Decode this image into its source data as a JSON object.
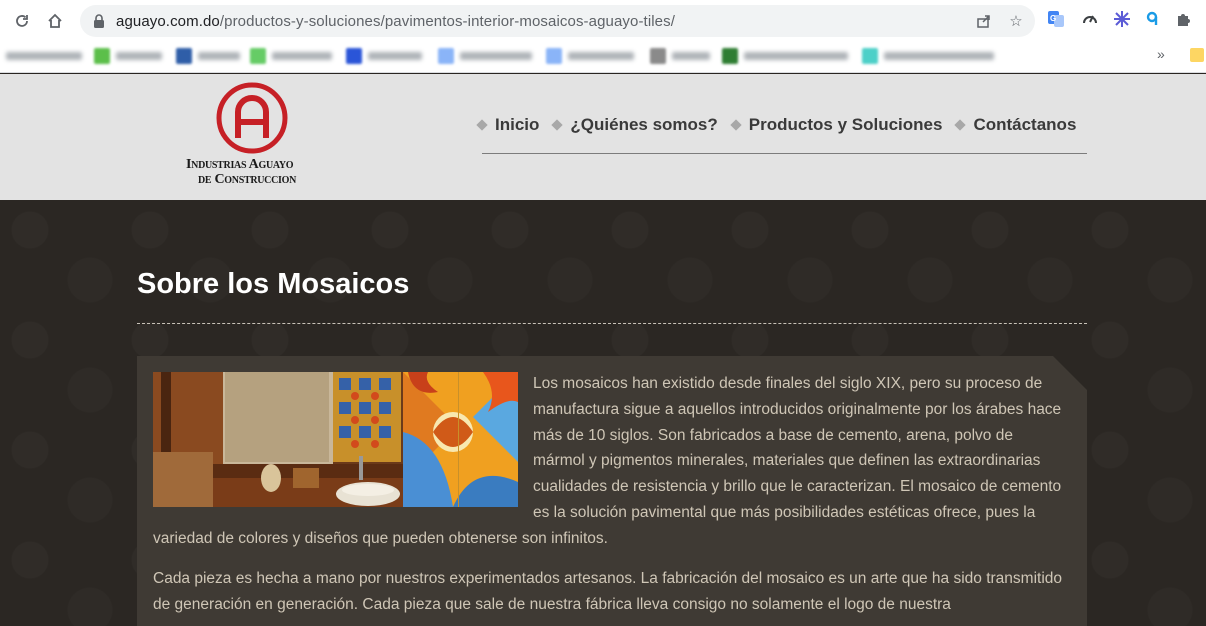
{
  "browser": {
    "url_domain": "aguayo.com.do",
    "url_path": "/productos-y-soluciones/pavimentos-interior-mosaicos-aguayo-tiles/",
    "more_bookmarks": "»"
  },
  "site": {
    "logo_letter": "A",
    "logo_line1": "Industrias Aguayo",
    "logo_line2": "de Construccion",
    "brand_color": "#c62026",
    "menu": [
      {
        "label": "Inicio"
      },
      {
        "label": "¿Quiénes somos?"
      },
      {
        "label": "Productos y Soluciones"
      },
      {
        "label": "Contáctanos"
      }
    ]
  },
  "content": {
    "title": "Sobre los Mosaicos",
    "paragraph1": "Los mosaicos han existido desde finales del siglo XIX, pero su proceso de manufactura sigue a aquellos introducidos originalmente por los árabes hace más de 10 siglos. Son fabricados a base de cemento, arena, polvo de mármol y pigmentos minerales, materiales que definen las extraordinarias cualidades de resistencia y brillo que le caracterizan. El mosaico de cemento es la solución pavimental que más posibilidades estéticas ofrece, pues la variedad de colores y diseños que pueden obtenerse son infinitos.",
    "paragraph2": "Cada pieza es hecha a mano por nuestros experimentados artesanos. La fabricación del mosaico es un arte que ha sido transmitido de generación en generación. Cada pieza que sale de nuestra fábrica lleva consigo no solamente el logo de nuestra"
  }
}
